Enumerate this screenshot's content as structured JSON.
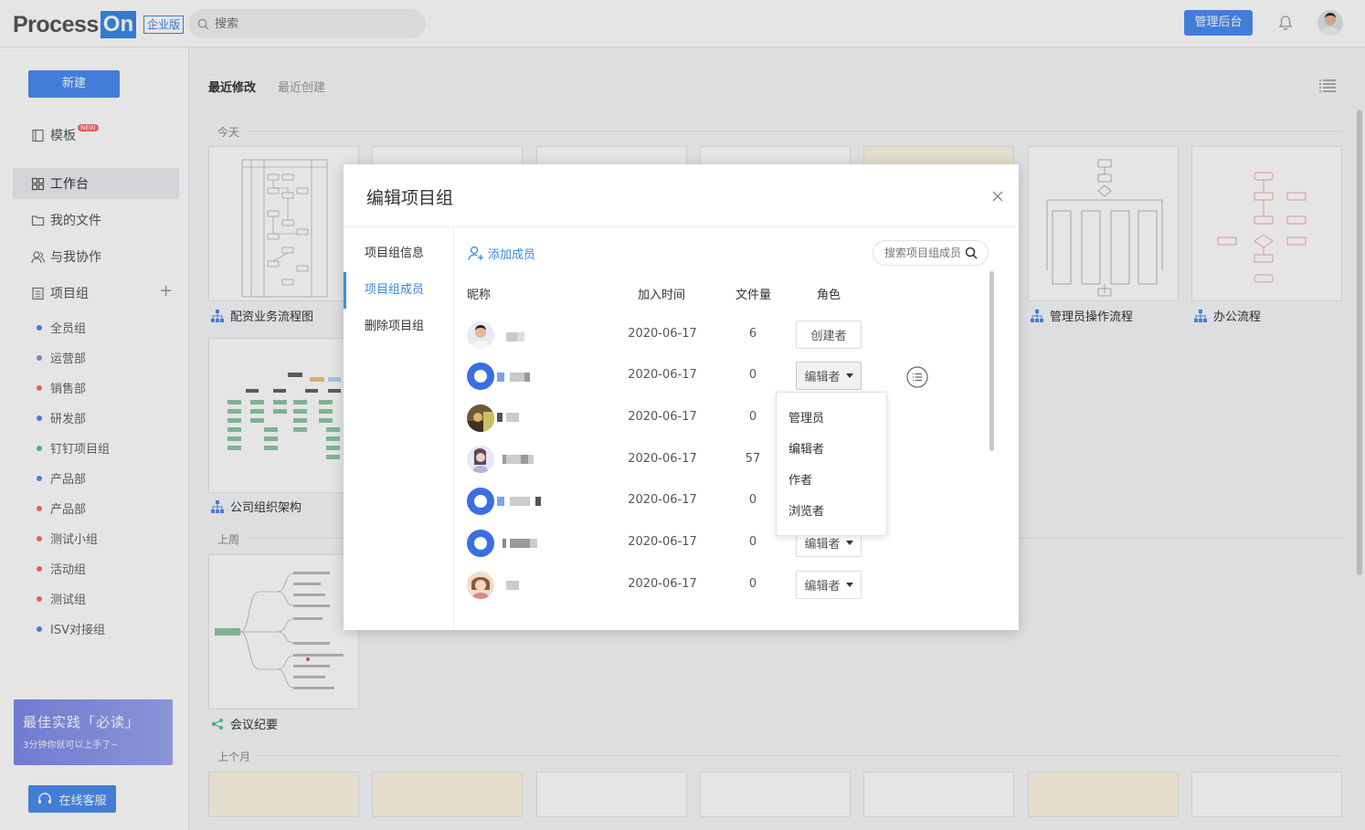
{
  "header": {
    "logo_process": "Process",
    "logo_on": "On",
    "logo_badge": "企业版",
    "search_placeholder": "搜索",
    "admin_button": "管理后台"
  },
  "sidebar": {
    "new_button": "新建",
    "nav": [
      {
        "label": "模板",
        "icon": "template-icon",
        "badge": "NEW"
      },
      {
        "label": "工作台",
        "icon": "grid-icon"
      },
      {
        "label": "我的文件",
        "icon": "folder-icon"
      },
      {
        "label": "与我协作",
        "icon": "collab-icon"
      },
      {
        "label": "项目组",
        "icon": "project-group-icon"
      }
    ],
    "groups": [
      {
        "label": "全员组",
        "color": "#4a8df0"
      },
      {
        "label": "运营部",
        "color": "#a97fe6"
      },
      {
        "label": "销售部",
        "color": "#f56c6c"
      },
      {
        "label": "研发部",
        "color": "#4a8df0"
      },
      {
        "label": "钉钉项目组",
        "color": "#4cc790"
      },
      {
        "label": "产品部",
        "color": "#4a8df0"
      },
      {
        "label": "产品部",
        "color": "#f56c6c"
      },
      {
        "label": "测试小组",
        "color": "#f56c6c"
      },
      {
        "label": "活动组",
        "color": "#f56c6c"
      },
      {
        "label": "测试组",
        "color": "#f56c6c"
      },
      {
        "label": "ISV对接组",
        "color": "#4a8df0"
      }
    ],
    "promo_title": "最佳实践「必读」",
    "promo_sub": "3分钟你就可以上手了~",
    "service_button": "在线客服"
  },
  "main": {
    "tab_recent_modified": "最近修改",
    "tab_recent_created": "最近创建",
    "sections": {
      "today": "今天",
      "last_week": "上周",
      "last_month": "上个月"
    },
    "cards": {
      "c1": "配资业务流程图",
      "c2": "管理员操作流程",
      "c3": "办公流程",
      "c4": "公司组织架构",
      "c5": "会议纪要"
    }
  },
  "modal": {
    "title": "编辑项目组",
    "side": [
      "项目组信息",
      "项目组成员",
      "删除项目组"
    ],
    "add_member": "添加成员",
    "search_placeholder": "搜索项目组成员",
    "headers": {
      "nickname": "昵称",
      "joined": "加入时间",
      "files": "文件量",
      "role": "角色"
    },
    "rows": [
      {
        "date": "2020-06-17",
        "files": "6",
        "role": "创建者"
      },
      {
        "date": "2020-06-17",
        "files": "0",
        "role": "编辑者"
      },
      {
        "date": "2020-06-17",
        "files": "0",
        "role": ""
      },
      {
        "date": "2020-06-17",
        "files": "57",
        "role": ""
      },
      {
        "date": "2020-06-17",
        "files": "0",
        "role": ""
      },
      {
        "date": "2020-06-17",
        "files": "0",
        "role": "编辑者"
      },
      {
        "date": "2020-06-17",
        "files": "0",
        "role": "编辑者"
      }
    ],
    "dropdown": [
      "管理员",
      "编辑者",
      "作者",
      "浏览者"
    ]
  }
}
